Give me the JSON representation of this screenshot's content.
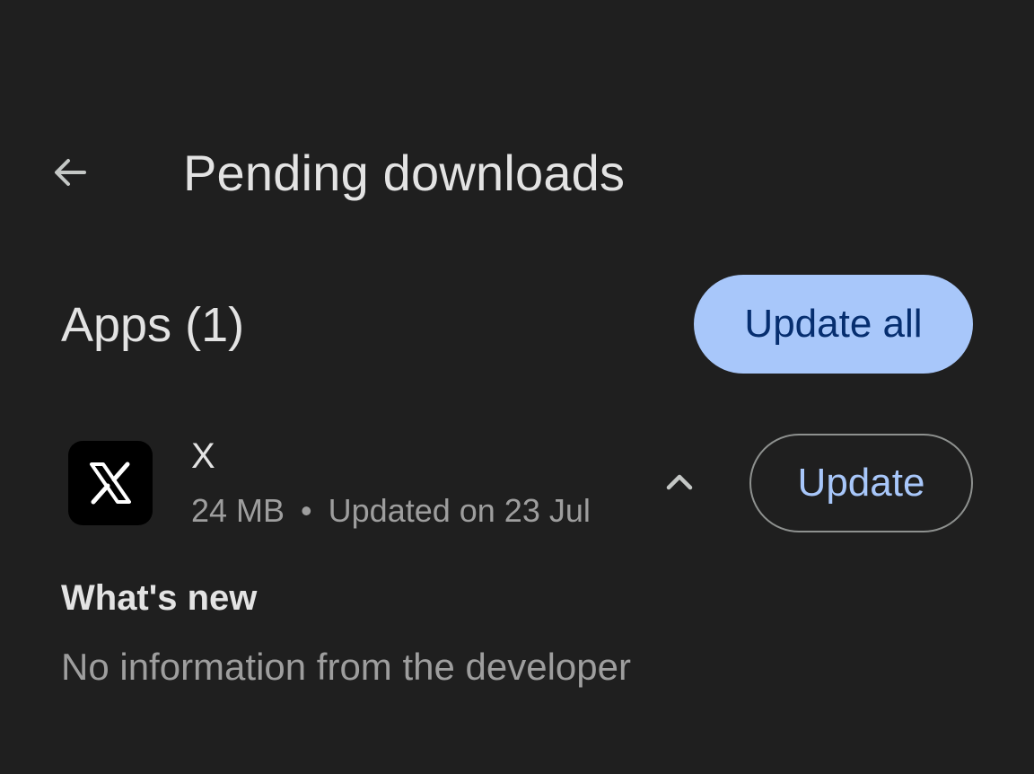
{
  "header": {
    "back_icon": "arrow-back-icon",
    "title": "Pending downloads"
  },
  "section": {
    "title": "Apps (1)",
    "update_all_label": "Update all"
  },
  "app": {
    "icon": "x-logo-icon",
    "name": "X",
    "size": "24 MB",
    "separator": "•",
    "updated": "Updated on 23 Jul",
    "expand_icon": "chevron-up-icon",
    "update_label": "Update"
  },
  "whats_new": {
    "title": "What's new",
    "body": "No information from the developer"
  },
  "colors": {
    "background": "#1f1f1f",
    "accent": "#a8c7fa",
    "on_accent": "#062e6f",
    "primary_text": "#e3e3e3",
    "secondary_text": "#9e9e9e",
    "outline": "#8e918f"
  }
}
